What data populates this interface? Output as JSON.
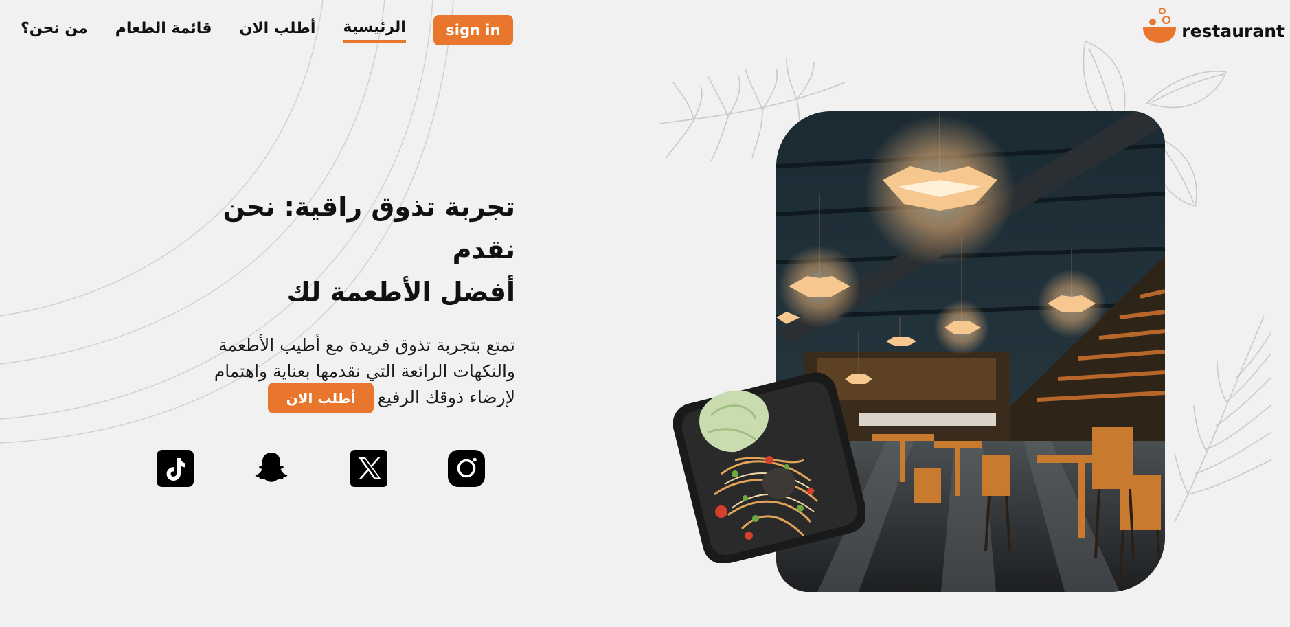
{
  "nav": {
    "links": [
      {
        "label": "من نحن؟"
      },
      {
        "label": "قائمة الطعام"
      },
      {
        "label": "أطلب الان"
      },
      {
        "label": "الرئيسية"
      }
    ],
    "signin_label": "sign in"
  },
  "brand": {
    "name": "restaurant",
    "logo_icon": "bowl-logo-icon"
  },
  "hero": {
    "title_line1": "تجربة تذوق راقية: نحن نقدم",
    "title_line2": "أفضل الأطعمة لك",
    "subtitle_line1": "تمتع بتجربة تذوق فريدة مع أطيب الأطعمة",
    "subtitle_line2": "والنكهات الرائعة التي نقدمها بعناية واهتمام",
    "subtitle_line3": "لإرضاء ذوقك الرفيع",
    "cta_label": "أطلب الان"
  },
  "socials": [
    {
      "icon": "tiktok-icon"
    },
    {
      "icon": "snapchat-icon"
    },
    {
      "icon": "x-twitter-icon"
    },
    {
      "icon": "instagram-icon"
    }
  ],
  "colors": {
    "accent": "#e8762c",
    "background": "#f1f1f1",
    "text": "#111111"
  }
}
